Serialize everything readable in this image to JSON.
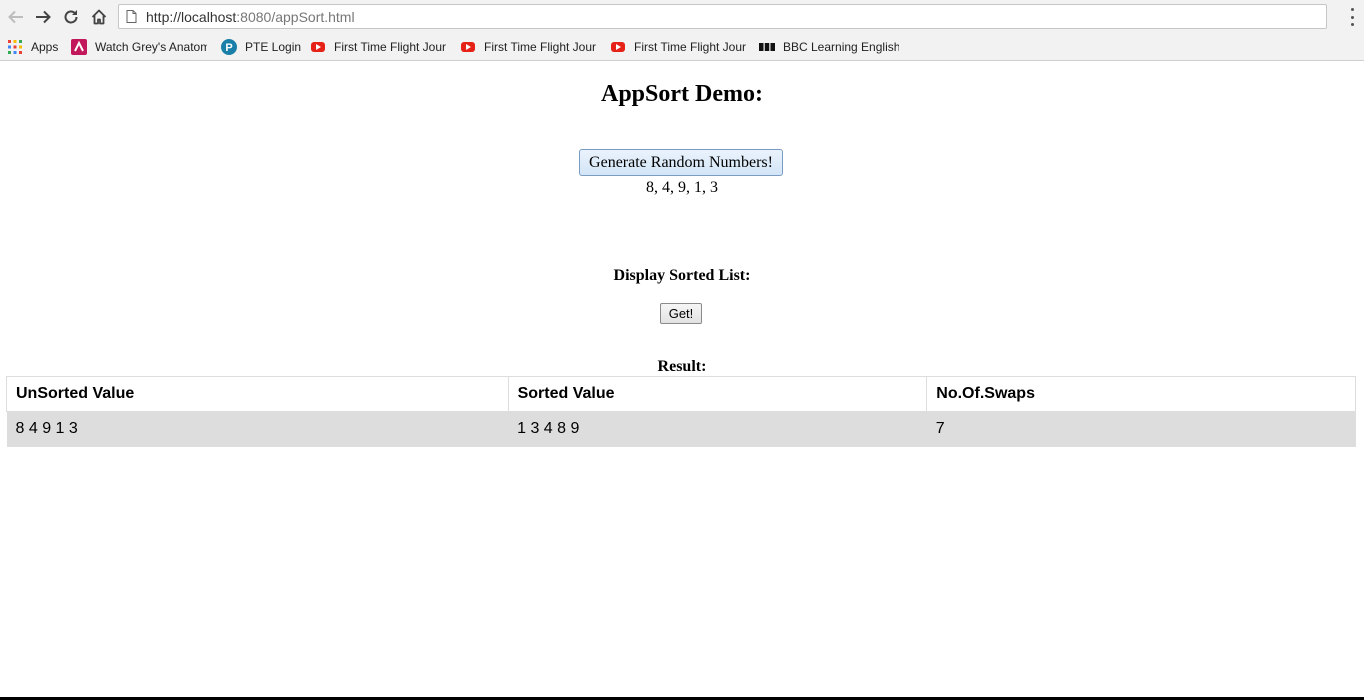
{
  "browser": {
    "url_host": "http://localhost",
    "url_rest": ":8080/appSort.html",
    "bookmarks": [
      {
        "label": "Apps",
        "icon": "apps-grid-icon"
      },
      {
        "label": "Watch Grey's Anatom",
        "icon": "tv-show-icon"
      },
      {
        "label": "PTE Login",
        "icon": "pearson-icon"
      },
      {
        "label": "First Time Flight Jour",
        "icon": "youtube-icon"
      },
      {
        "label": "First Time Flight Jour",
        "icon": "youtube-icon"
      },
      {
        "label": "First Time Flight Jour",
        "icon": "youtube-icon"
      },
      {
        "label": "BBC Learning English",
        "icon": "bbc-icon"
      }
    ]
  },
  "page": {
    "title": "AppSort Demo:",
    "generate_label": "Generate Random Numbers!",
    "random_values": "8, 4, 9, 1, 3",
    "sorted_heading": "Display Sorted List:",
    "get_label": "Get!",
    "result_heading": "Result:"
  },
  "table": {
    "headers": [
      "UnSorted Value",
      "Sorted Value",
      "No.Of.Swaps"
    ],
    "rows": [
      [
        "8 4 9 1 3",
        "1 3 4 8 9",
        "7"
      ]
    ]
  }
}
